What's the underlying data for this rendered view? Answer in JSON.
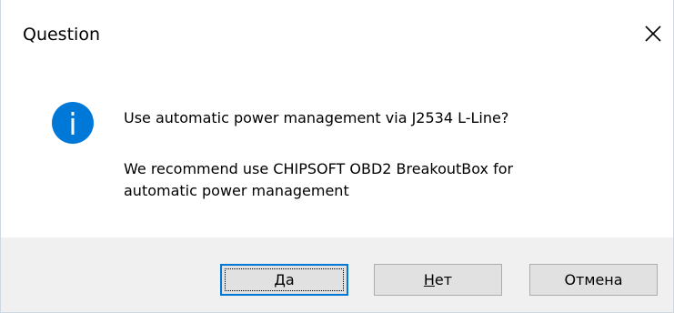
{
  "dialog": {
    "title": "Question",
    "message_line1": "Use automatic power management via J2534 L-Line?",
    "message_line2": "We recommend use CHIPSOFT OBD2 BreakoutBox for",
    "message_line3": "automatic power management",
    "icon": "info-icon",
    "close_icon": "close-icon"
  },
  "buttons": {
    "yes": {
      "accel": "Д",
      "rest": "а"
    },
    "no": {
      "accel": "Н",
      "rest": "ет"
    },
    "cancel": {
      "label": "Отмена"
    }
  },
  "colors": {
    "icon_blue": "#0078d7",
    "footer_bg": "#f0f0f0",
    "button_bg": "#e1e1e1",
    "button_border": "#adadad",
    "default_button_border": "#0078d7"
  }
}
